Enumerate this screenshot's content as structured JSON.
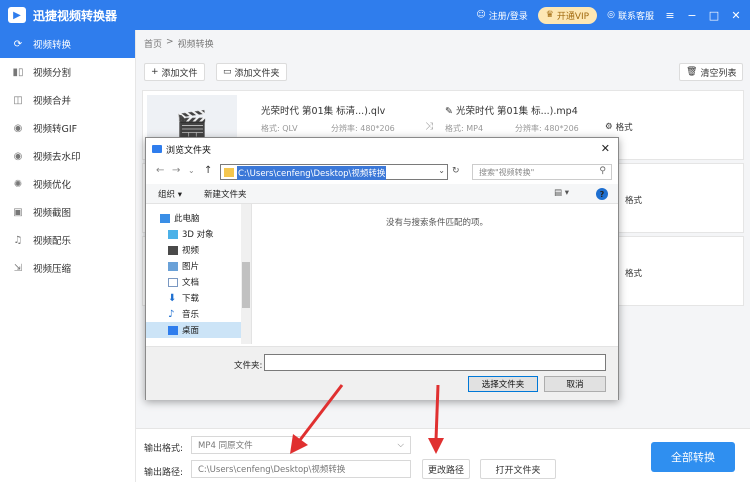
{
  "app": {
    "title": "迅捷视频转换器",
    "logo_text": "▶"
  },
  "titlebar": {
    "login": "注册/登录",
    "vip": "开通VIP",
    "support": "联系客服"
  },
  "sidebar": {
    "items": [
      {
        "label": "视频转换",
        "icon": "convert-icon"
      },
      {
        "label": "视频分割",
        "icon": "split-icon"
      },
      {
        "label": "视频合并",
        "icon": "merge-icon"
      },
      {
        "label": "视频转GIF",
        "icon": "gif-icon"
      },
      {
        "label": "视频去水印",
        "icon": "watermark-icon"
      },
      {
        "label": "视频优化",
        "icon": "optimize-icon"
      },
      {
        "label": "视频截图",
        "icon": "screenshot-icon"
      },
      {
        "label": "视频配乐",
        "icon": "music-icon"
      },
      {
        "label": "视频压缩",
        "icon": "compress-icon"
      }
    ]
  },
  "breadcrumb": {
    "home": "首页",
    "sep": ">",
    "current": "视频转换"
  },
  "toolbar": {
    "add_file": "添加文件",
    "add_folder": "添加文件夹",
    "clear_list": "清空列表"
  },
  "files": [
    {
      "src_name": "光荣时代 第01集 标清...).qlv",
      "src_format": "格式: QLV",
      "src_res": "分辨率: 480*206",
      "dst_name": "光荣时代 第01集 标...).mp4",
      "dst_format": "格式: MP4",
      "dst_res": "分辨率: 480*206",
      "format_label": "格式"
    },
    {
      "format_label": "格式"
    },
    {
      "format_label": "格式"
    }
  ],
  "bottom": {
    "output_format_label": "输出格式:",
    "output_format_value": "MP4  同原文件",
    "output_path_label": "输出路径:",
    "output_path_value": "C:\\Users\\cenfeng\\Desktop\\视频转换",
    "change_path": "更改路径",
    "open_folder": "打开文件夹",
    "convert_all": "全部转换"
  },
  "dialog": {
    "title": "浏览文件夹",
    "address": "C:\\Users\\cenfeng\\Desktop\\视频转换",
    "search_placeholder": "搜索\"视频转换\"",
    "organize": "组织 ▾",
    "new_folder": "新建文件夹",
    "empty_message": "没有与搜索条件匹配的项。",
    "tree": [
      "此电脑",
      "3D 对象",
      "视频",
      "图片",
      "文档",
      "下载",
      "音乐",
      "桌面",
      "..."
    ],
    "folder_label": "文件夹:",
    "select_button": "选择文件夹",
    "cancel_button": "取消"
  },
  "colors": {
    "brand": "#2f7ded",
    "annotation_arrow": "#e03030"
  }
}
